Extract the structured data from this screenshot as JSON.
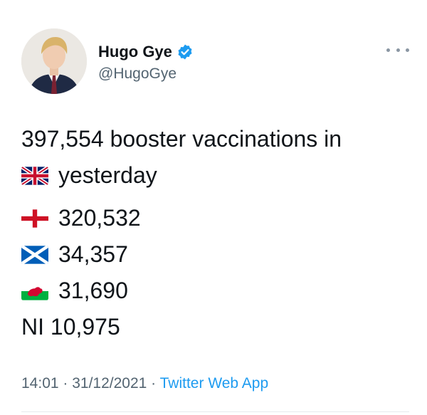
{
  "author": {
    "display_name": "Hugo Gye",
    "handle": "@HugoGye",
    "verified_icon": "verified-badge-icon"
  },
  "tweet": {
    "line1": "397,554 booster vaccinations in",
    "line2_flag": "uk-flag-icon",
    "line2": "yesterday",
    "rows": [
      {
        "flag": "england-flag-icon",
        "value": "320,532"
      },
      {
        "flag": "scotland-flag-icon",
        "value": "34,357"
      },
      {
        "flag": "wales-flag-icon",
        "value": "31,690"
      }
    ],
    "ni_row": "NI 10,975"
  },
  "meta": {
    "time": "14:01",
    "sep1": " · ",
    "date": "31/12/2021",
    "sep2": " · ",
    "app": "Twitter Web App"
  },
  "colors": {
    "text": "#0f1419",
    "secondary": "#536471",
    "link": "#1d9bf0"
  }
}
